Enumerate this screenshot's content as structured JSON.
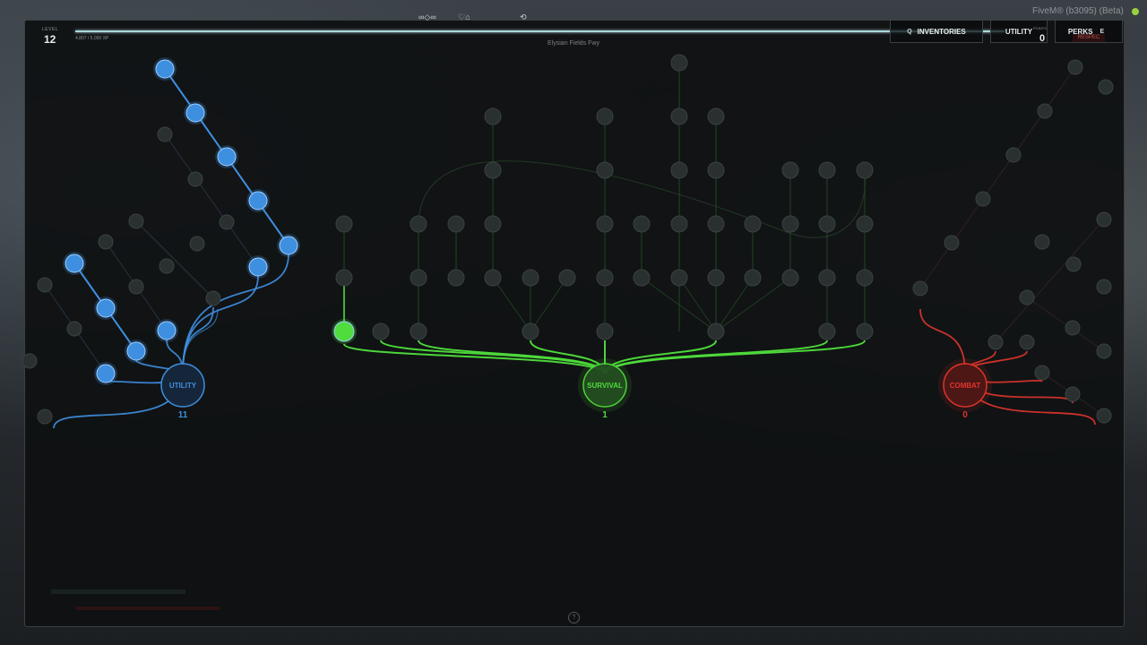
{
  "app": {
    "fivem_label": "FiveM® (b3095) (Beta)"
  },
  "header": {
    "level_caption": "LEVEL",
    "level_value": "12",
    "xp_text": "4,807 / 5,000 XP",
    "xp_progress": 0.96,
    "location": "Elysian Fields Fwy",
    "hud_icons": [
      "∞◇∞",
      "♡⌂",
      "⟲"
    ]
  },
  "nav": {
    "inventories": {
      "key": "Q",
      "label": "INVENTORIES"
    },
    "utility": {
      "label": "UTILITY",
      "points_caption": "POINTS",
      "points": "0"
    },
    "perks": {
      "label": "PERKS",
      "key": "E"
    },
    "respec": "RESPEC"
  },
  "categories": [
    {
      "id": "utility",
      "label": "UTILITY",
      "count": "11",
      "color": "#3f8fe0"
    },
    {
      "id": "survival",
      "label": "SURVIVAL",
      "count": "1",
      "color": "#4fdc3c"
    },
    {
      "id": "combat",
      "label": "COMBAT",
      "count": "0",
      "color": "#e0352c"
    }
  ],
  "colors": {
    "utility": "#3f8fe0",
    "survival": "#4fdc3c",
    "combat": "#e0352c",
    "locked": "#2a3030",
    "locked_stroke": "#3a4242",
    "panel": "#0e1011"
  },
  "icons": {
    "help": "question-icon"
  },
  "help_symbol": "?"
}
